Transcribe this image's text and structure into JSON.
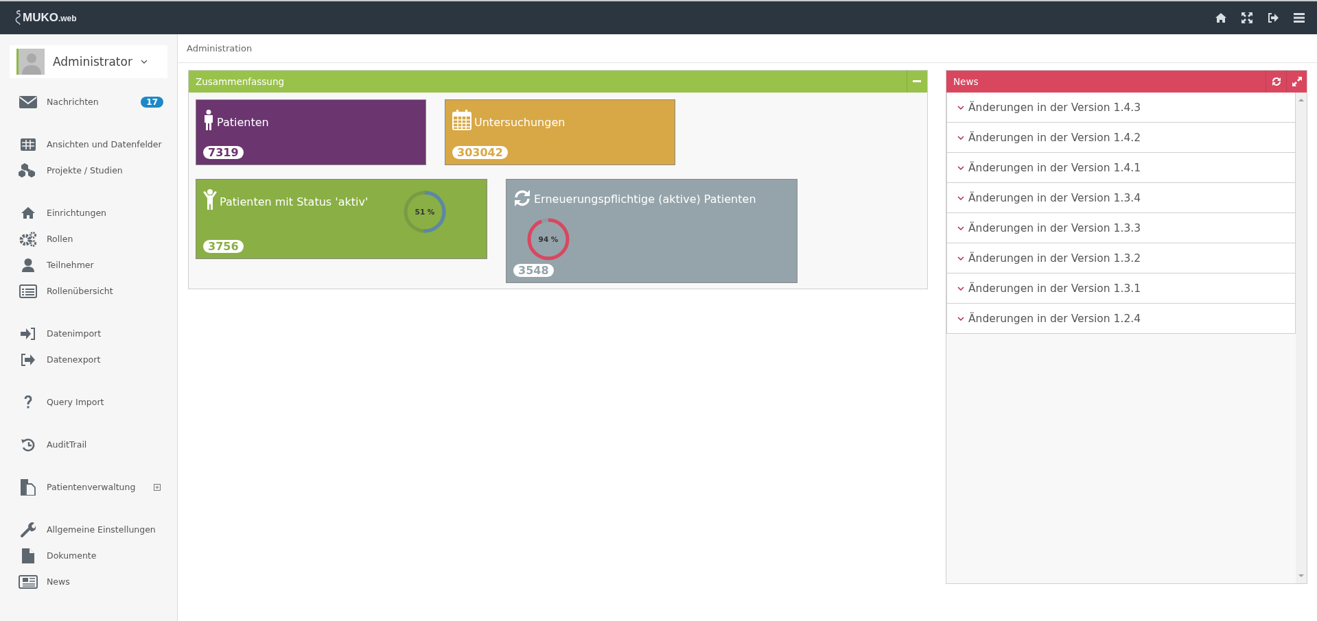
{
  "topbar": {
    "logo": {
      "name": "MUKO",
      "suffix": ".web"
    }
  },
  "user": {
    "name": "Administrator"
  },
  "sidebar": {
    "groups": [
      [
        {
          "label": "Nachrichten",
          "badge": "17"
        }
      ],
      [
        {
          "label": "Ansichten und Datenfelder"
        },
        {
          "label": "Projekte / Studien"
        }
      ],
      [
        {
          "label": "Einrichtungen"
        },
        {
          "label": "Rollen"
        },
        {
          "label": "Teilnehmer"
        },
        {
          "label": "Rollenübersicht"
        }
      ],
      [
        {
          "label": "Datenimport"
        },
        {
          "label": "Datenexport"
        }
      ],
      [
        {
          "label": "Query Import"
        }
      ],
      [
        {
          "label": "AuditTrail"
        }
      ],
      [
        {
          "label": "Patientenverwaltung",
          "expandable": true
        }
      ],
      [
        {
          "label": "Allgemeine Einstellungen"
        },
        {
          "label": "Dokumente"
        },
        {
          "label": "News"
        }
      ]
    ]
  },
  "breadcrumb": "Administration",
  "summary": {
    "title": "Zusammenfassung",
    "rows": [
      [
        {
          "kind": "count",
          "title": "Patienten",
          "value": "7319",
          "color": "#6b3570"
        },
        {
          "kind": "count",
          "title": "Untersuchungen",
          "value": "303042",
          "color": "#d8a846"
        }
      ],
      [
        {
          "kind": "progress",
          "title": "Patienten mit Status 'aktiv'",
          "value": "3756",
          "color": "#8aaf45",
          "level": 0.51,
          "reading": "51 %"
        },
        {
          "kind": "progress",
          "title": "Erneuerungspflichtige (aktive) Patienten",
          "value": "3548",
          "color": "#95a4ab",
          "level": 0.94,
          "reading": "94 %"
        }
      ]
    ]
  },
  "news": {
    "title": "News",
    "items": [
      {
        "label": "Änderungen in der Version 1.4.3"
      },
      {
        "label": "Änderungen in der Version 1.4.2"
      },
      {
        "label": "Änderungen in der Version 1.4.1"
      },
      {
        "label": "Änderungen in der Version 1.3.4"
      },
      {
        "label": "Änderungen in der Version 1.3.3"
      },
      {
        "label": "Änderungen in der Version 1.3.2"
      },
      {
        "label": "Änderungen in der Version 1.3.1"
      },
      {
        "label": "Änderungen in der Version 1.2.4"
      }
    ]
  }
}
